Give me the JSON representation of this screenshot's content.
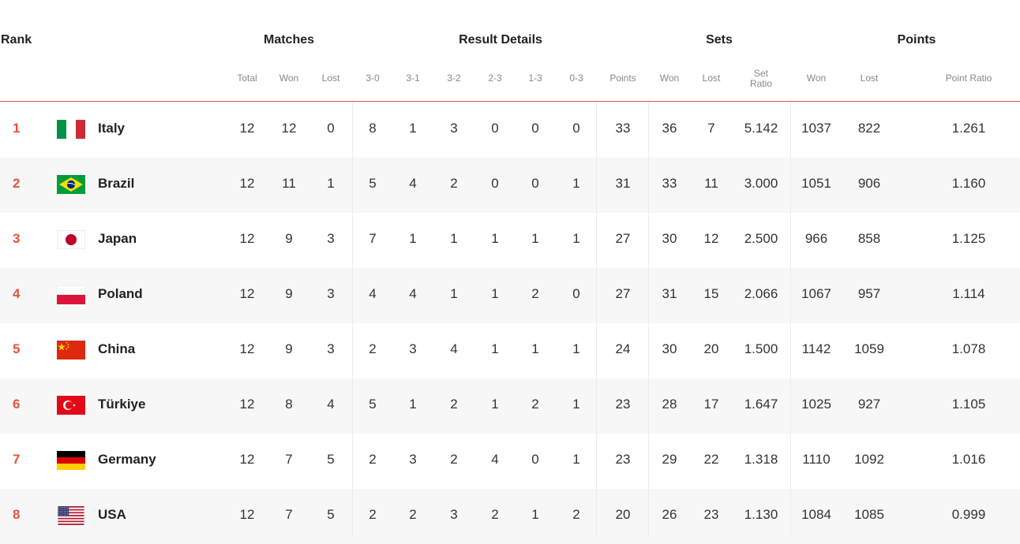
{
  "header": {
    "groups": {
      "rank": "Rank",
      "matches": "Matches",
      "result_details": "Result Details",
      "sets": "Sets",
      "points": "Points"
    },
    "columns": {
      "matches_total": "Total",
      "matches_won": "Won",
      "matches_lost": "Lost",
      "r30": "3-0",
      "r31": "3-1",
      "r32": "3-2",
      "r23": "2-3",
      "r13": "1-3",
      "r03": "0-3",
      "points": "Points",
      "sets_won": "Won",
      "sets_lost": "Lost",
      "set_ratio": "Set Ratio",
      "points_won": "Won",
      "points_lost": "Lost",
      "point_ratio": "Point Ratio"
    }
  },
  "colors": {
    "accent": "#e5533d",
    "row_alt": "#f7f7f7",
    "header_line": "#d9534f"
  },
  "rows": [
    {
      "rank": "1",
      "flag": "italy-flag-icon",
      "team": "Italy",
      "total": "12",
      "won": "12",
      "lost": "0",
      "r30": "8",
      "r31": "1",
      "r32": "3",
      "r23": "0",
      "r13": "0",
      "r03": "0",
      "points": "33",
      "sets_won": "36",
      "sets_lost": "7",
      "set_ratio": "5.142",
      "points_won": "1037",
      "points_lost": "822",
      "point_ratio": "1.261"
    },
    {
      "rank": "2",
      "flag": "brazil-flag-icon",
      "team": "Brazil",
      "total": "12",
      "won": "11",
      "lost": "1",
      "r30": "5",
      "r31": "4",
      "r32": "2",
      "r23": "0",
      "r13": "0",
      "r03": "1",
      "points": "31",
      "sets_won": "33",
      "sets_lost": "11",
      "set_ratio": "3.000",
      "points_won": "1051",
      "points_lost": "906",
      "point_ratio": "1.160"
    },
    {
      "rank": "3",
      "flag": "japan-flag-icon",
      "team": "Japan",
      "total": "12",
      "won": "9",
      "lost": "3",
      "r30": "7",
      "r31": "1",
      "r32": "1",
      "r23": "1",
      "r13": "1",
      "r03": "1",
      "points": "27",
      "sets_won": "30",
      "sets_lost": "12",
      "set_ratio": "2.500",
      "points_won": "966",
      "points_lost": "858",
      "point_ratio": "1.125"
    },
    {
      "rank": "4",
      "flag": "poland-flag-icon",
      "team": "Poland",
      "total": "12",
      "won": "9",
      "lost": "3",
      "r30": "4",
      "r31": "4",
      "r32": "1",
      "r23": "1",
      "r13": "2",
      "r03": "0",
      "points": "27",
      "sets_won": "31",
      "sets_lost": "15",
      "set_ratio": "2.066",
      "points_won": "1067",
      "points_lost": "957",
      "point_ratio": "1.114"
    },
    {
      "rank": "5",
      "flag": "china-flag-icon",
      "team": "China",
      "total": "12",
      "won": "9",
      "lost": "3",
      "r30": "2",
      "r31": "3",
      "r32": "4",
      "r23": "1",
      "r13": "1",
      "r03": "1",
      "points": "24",
      "sets_won": "30",
      "sets_lost": "20",
      "set_ratio": "1.500",
      "points_won": "1142",
      "points_lost": "1059",
      "point_ratio": "1.078"
    },
    {
      "rank": "6",
      "flag": "turkiye-flag-icon",
      "team": "Türkiye",
      "total": "12",
      "won": "8",
      "lost": "4",
      "r30": "5",
      "r31": "1",
      "r32": "2",
      "r23": "1",
      "r13": "2",
      "r03": "1",
      "points": "23",
      "sets_won": "28",
      "sets_lost": "17",
      "set_ratio": "1.647",
      "points_won": "1025",
      "points_lost": "927",
      "point_ratio": "1.105"
    },
    {
      "rank": "7",
      "flag": "germany-flag-icon",
      "team": "Germany",
      "total": "12",
      "won": "7",
      "lost": "5",
      "r30": "2",
      "r31": "3",
      "r32": "2",
      "r23": "4",
      "r13": "0",
      "r03": "1",
      "points": "23",
      "sets_won": "29",
      "sets_lost": "22",
      "set_ratio": "1.318",
      "points_won": "1110",
      "points_lost": "1092",
      "point_ratio": "1.016"
    },
    {
      "rank": "8",
      "flag": "usa-flag-icon",
      "team": "USA",
      "total": "12",
      "won": "7",
      "lost": "5",
      "r30": "2",
      "r31": "2",
      "r32": "3",
      "r23": "2",
      "r13": "1",
      "r03": "2",
      "points": "20",
      "sets_won": "26",
      "sets_lost": "23",
      "set_ratio": "1.130",
      "points_won": "1084",
      "points_lost": "1085",
      "point_ratio": "0.999"
    }
  ]
}
